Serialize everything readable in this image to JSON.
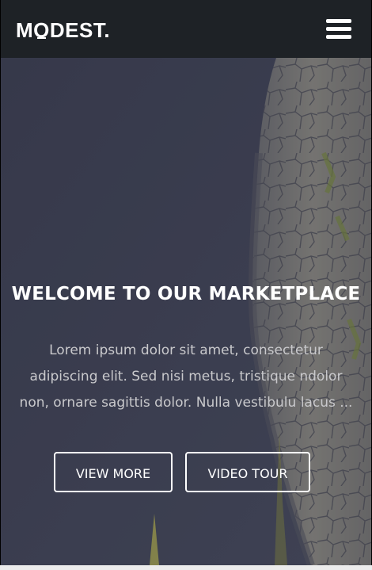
{
  "header": {
    "logo_text_part1": "M",
    "logo_text_o": "O",
    "logo_text_part2": "DEST."
  },
  "hero": {
    "title": "WELCOME TO OUR MARKETPLACE",
    "paragraph_lines": [
      "Lorem ipsum dolor sit amet, consectetur",
      "adipiscing elit. Sed nisi metus, tristique ndolor",
      "non, ornare sagittis dolor. Nulla vestibulu lacus ..."
    ],
    "buttons": {
      "view_more": "VIEW MORE",
      "video_tour": "VIDEO TOUR"
    }
  },
  "colors": {
    "navbar_bg": "#1e2226",
    "hero_overlay": "#3f4153",
    "text_primary": "#ffffff",
    "text_muted": "#c9c9cc"
  },
  "icons": {
    "menu": "hamburger-menu-icon"
  }
}
